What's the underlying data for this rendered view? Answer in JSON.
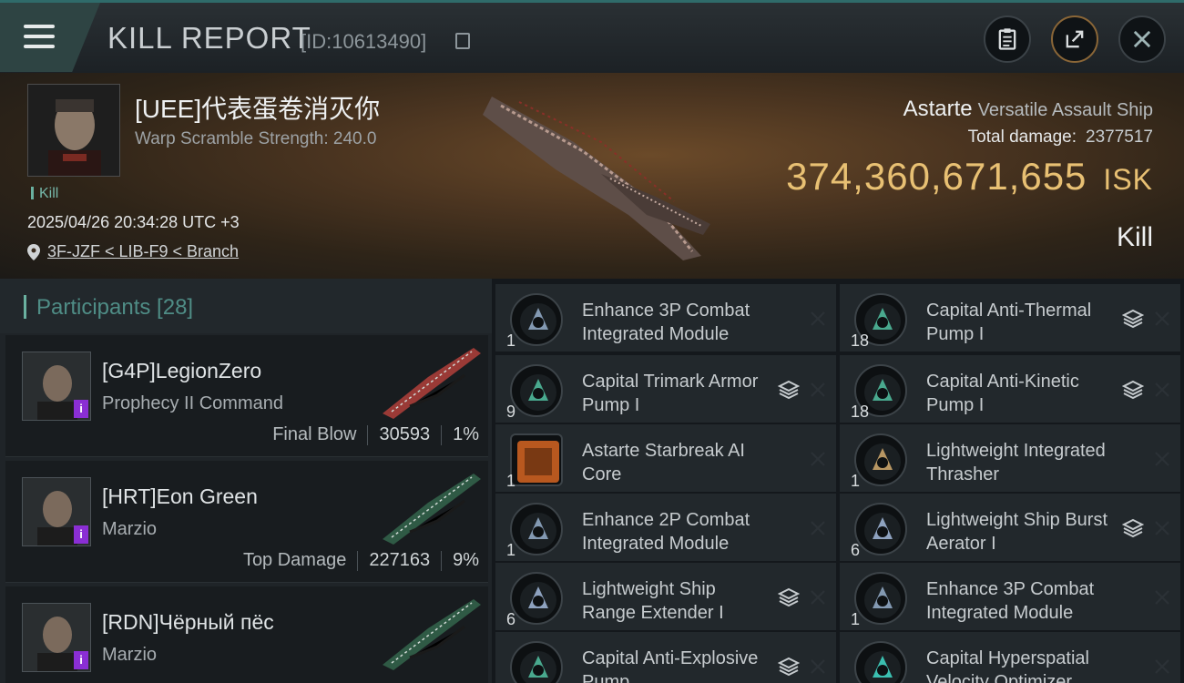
{
  "header": {
    "title": "KILL REPORT",
    "report_id": "[ID:10613490]"
  },
  "victim": {
    "name": "[UEE]代表蛋卷消灭你",
    "warp_scramble": "Warp Scramble Strength: 240.0",
    "tag": "Kill",
    "timestamp": "2025/04/26 20:34:28 UTC +3",
    "location": "3F-JZF < LIB-F9 < Branch",
    "ship_name": "Astarte",
    "ship_class": "Versatile Assault Ship",
    "total_damage_label": "Total damage:",
    "total_damage": "2377517",
    "isk_value": "374,360,671,655",
    "isk_unit": "ISK",
    "result": "Kill"
  },
  "participants": {
    "label": "Participants [28]",
    "list": [
      {
        "name": "[G4P]LegionZero",
        "ship": "Prophecy II Command",
        "role": "Final Blow",
        "damage": "30593",
        "percent": "1%",
        "ship_color": "#9a3a36"
      },
      {
        "name": "[HRT]Eon Green",
        "ship": "Marzio",
        "role": "Top Damage",
        "damage": "227163",
        "percent": "9%",
        "ship_color": "#2f5a45"
      },
      {
        "name": "[RDN]Чёрный пёс",
        "ship": "Marzio",
        "role": "",
        "damage": "",
        "percent": "",
        "ship_color": "#2f5a45"
      }
    ]
  },
  "items": [
    {
      "name": "Enhance 3P Combat Integrated Module",
      "qty": "1",
      "icon": "combat-module-icon",
      "stack": false,
      "color": "#8fa6c2"
    },
    {
      "name": "Capital Anti-Thermal Pump I",
      "qty": "18",
      "icon": "armor-pump-icon",
      "stack": true,
      "color": "#4fb89a"
    },
    {
      "name": "Capital Trimark Armor Pump I",
      "qty": "9",
      "icon": "armor-pump-icon",
      "stack": true,
      "color": "#4fb89a"
    },
    {
      "name": "Capital Anti-Kinetic Pump I",
      "qty": "18",
      "icon": "armor-pump-icon",
      "stack": true,
      "color": "#4fb89a"
    },
    {
      "name": "Astarte Starbreak AI Core",
      "qty": "1",
      "icon": "ai-core-icon",
      "stack": false,
      "color": "#b8581f"
    },
    {
      "name": "Lightweight Integrated Thrasher",
      "qty": "1",
      "icon": "thrasher-icon",
      "stack": false,
      "color": "#c9a36a"
    },
    {
      "name": "Enhance 2P Combat Integrated Module",
      "qty": "1",
      "icon": "combat-module-icon",
      "stack": false,
      "color": "#8fa6c2"
    },
    {
      "name": "Lightweight Ship Burst Aerator I",
      "qty": "6",
      "icon": "aerator-icon",
      "stack": true,
      "color": "#9bb0d0"
    },
    {
      "name": "Lightweight Ship Range Extender I",
      "qty": "6",
      "icon": "extender-icon",
      "stack": true,
      "color": "#9bb0d0"
    },
    {
      "name": "Enhance 3P Combat Integrated Module",
      "qty": "1",
      "icon": "combat-module-icon",
      "stack": false,
      "color": "#8fa6c2"
    },
    {
      "name": "Capital Anti-Explosive Pump",
      "qty": "",
      "icon": "armor-pump-icon",
      "stack": true,
      "color": "#4fb89a"
    },
    {
      "name": "Capital Hyperspatial Velocity Optimizer",
      "qty": "",
      "icon": "optimizer-icon",
      "stack": false,
      "color": "#3fd0c0"
    }
  ]
}
